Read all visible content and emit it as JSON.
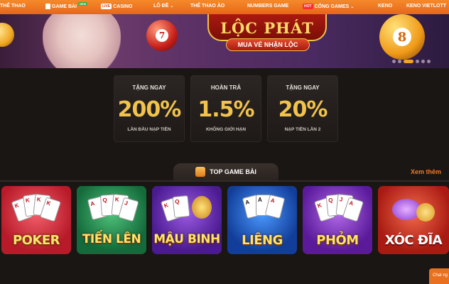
{
  "nav": {
    "items": [
      {
        "label": "THỂ THAO"
      },
      {
        "label": "GAME BÀI",
        "badge": "NEW"
      },
      {
        "label": "CASINO",
        "tag": "LIVE"
      },
      {
        "label": "LÔ ĐỀ"
      },
      {
        "label": "THỂ THAO ẢO"
      },
      {
        "label": "NUMBERS GAME"
      },
      {
        "label": "CỔNG GAMES",
        "tag": "HOT"
      },
      {
        "label": "KENO"
      },
      {
        "label": "KENO VIETLOTT"
      }
    ]
  },
  "banner": {
    "title": "LỘC PHÁT",
    "subtitle": "MUA VÉ NHẬN LỘC",
    "ball_left": "",
    "ball_7": "7",
    "ball_8": "8",
    "slide_count": 6,
    "active_slide": 2
  },
  "promos": [
    {
      "title": "TẶNG NGAY",
      "value": "200%",
      "desc": "LẦN ĐẦU NẠP TIỀN"
    },
    {
      "title": "HOÀN TRẢ",
      "value": "1.5%",
      "desc": "KHÔNG GIỚI HẠN"
    },
    {
      "title": "TẶNG NGAY",
      "value": "20%",
      "desc": "NẠP TIỀN LẦN 2"
    }
  ],
  "section": {
    "title": "TOP GAME BÀI",
    "see_more": "Xem thêm"
  },
  "games": [
    {
      "name": "POKER",
      "color": "#d6303a"
    },
    {
      "name": "TIẾN LÊN",
      "color": "#1f8a4a"
    },
    {
      "name": "MẬU BINH",
      "color": "#6a2bb8"
    },
    {
      "name": "LIÊNG",
      "color": "#2160c8"
    },
    {
      "name": "PHỎM",
      "color": "#7a2fb0"
    },
    {
      "name": "XÓC ĐĨA",
      "color": "#c8281e"
    }
  ],
  "chat": {
    "label": "Chat ng"
  }
}
